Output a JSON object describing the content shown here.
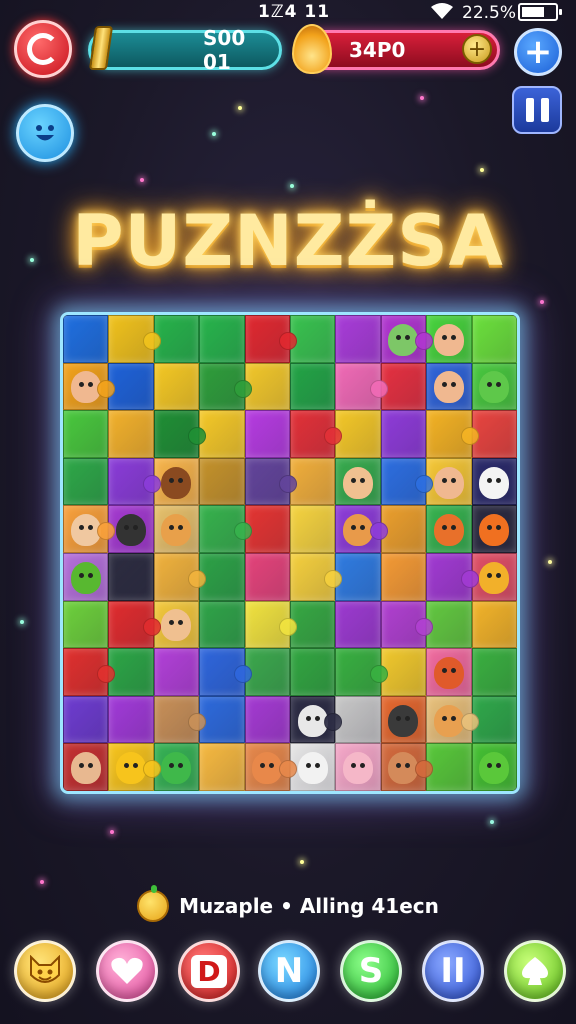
{
  "status_bar": {
    "time": "1ℤ4 11",
    "battery_percent": "22.5%"
  },
  "hud": {
    "left_counter": "S00 01",
    "right_counter": "34P0",
    "plus_label": "+",
    "coin_plus_label": "+",
    "pause_label": "II"
  },
  "title": "PUZNZŻSA",
  "board": {
    "columns": 10,
    "rows": 10,
    "tile_colors": [
      "#1f6fe0",
      "#f0c21c",
      "#26b34a",
      "#27b44b",
      "#e0282f",
      "#38c24e",
      "#a83cd8",
      "#b035d0",
      "#47d33c",
      "#6be03c",
      "#f2a21b",
      "#1e62d8",
      "#f4c823",
      "#2e9e3a",
      "#f1c729",
      "#22a445",
      "#f06ab5",
      "#e53040",
      "#2f64d8",
      "#48c83e",
      "#49c83d",
      "#f2b12b",
      "#1f8f34",
      "#f4c827",
      "#b53be0",
      "#e23037",
      "#f3c727",
      "#8e3bd8",
      "#f3b223",
      "#e8443f",
      "#2ea848",
      "#8a3cd8",
      "#f7b44a",
      "#c4922a",
      "#62449a",
      "#f0ae3a",
      "#36aa4c",
      "#2c6ee0",
      "#f5c735",
      "#2a2a6a",
      "#f8a03a",
      "#a43ad0",
      "#e6c06a",
      "#36b24c",
      "#e43431",
      "#f5d33e",
      "#8d3cd8",
      "#eb9f2c",
      "#36b24e",
      "#2a2a40",
      "#b46fda",
      "#2c2c40",
      "#f0b23c",
      "#2ca246",
      "#e4437a",
      "#f4cf3d",
      "#2f7be0",
      "#f49a34",
      "#a13ad2",
      "#e04f66",
      "#6dd03c",
      "#e02c2e",
      "#f3c83a",
      "#2fa448",
      "#f0e23e",
      "#36a842",
      "#9c3ad0",
      "#b040d0",
      "#62c840",
      "#f2b329",
      "#e0302e",
      "#2ca646",
      "#b240d8",
      "#2e66dc",
      "#3ba84c",
      "#31a640",
      "#38b040",
      "#f0c82c",
      "#f06a9e",
      "#3ab040",
      "#6e3cd0",
      "#a13ad8",
      "#c89058",
      "#2d6adc",
      "#a43ad2",
      "#2c2c44",
      "#c7c7c7",
      "#e4682e",
      "#e8c07a",
      "#2fa84a",
      "#c43030",
      "#f7c41c",
      "#36b254",
      "#f6b940",
      "#e7884a",
      "#e6e6e6",
      "#f5a7c8",
      "#d46a3c",
      "#58c83a",
      "#44c032"
    ],
    "face_tiles": [
      {
        "index": 7,
        "color": "#7dc767"
      },
      {
        "index": 8,
        "color": "#f0b890"
      },
      {
        "index": 10,
        "color": "#f0b890"
      },
      {
        "index": 18,
        "color": "#f0b890"
      },
      {
        "index": 19,
        "color": "#5ec84a"
      },
      {
        "index": 32,
        "color": "#8a4a20"
      },
      {
        "index": 36,
        "color": "#f0c090"
      },
      {
        "index": 38,
        "color": "#f0b890"
      },
      {
        "index": 39,
        "color": "#f4f4f4"
      },
      {
        "index": 40,
        "color": "#f0c8a0"
      },
      {
        "index": 41,
        "color": "#333333"
      },
      {
        "index": 42,
        "color": "#e8a04a"
      },
      {
        "index": 46,
        "color": "#e89a4a"
      },
      {
        "index": 48,
        "color": "#e8702a"
      },
      {
        "index": 49,
        "color": "#f07020"
      },
      {
        "index": 50,
        "color": "#58b830"
      },
      {
        "index": 59,
        "color": "#f2b02a"
      },
      {
        "index": 62,
        "color": "#f0c090"
      },
      {
        "index": 78,
        "color": "#e05a2a"
      },
      {
        "index": 85,
        "color": "#e8e8e8"
      },
      {
        "index": 87,
        "color": "#3a3a3a"
      },
      {
        "index": 88,
        "color": "#e8a050"
      },
      {
        "index": 90,
        "color": "#e8b890"
      },
      {
        "index": 91,
        "color": "#f7c41c"
      },
      {
        "index": 92,
        "color": "#3fb84a"
      },
      {
        "index": 94,
        "color": "#e8884a"
      },
      {
        "index": 95,
        "color": "#f2f2f2"
      },
      {
        "index": 96,
        "color": "#f5b7c8"
      },
      {
        "index": 97,
        "color": "#d48a5a"
      },
      {
        "index": 99,
        "color": "#5ac83a"
      }
    ]
  },
  "footer": {
    "text": "Muzaple • Alling 41ecn"
  },
  "dock": {
    "btn3_label": "D",
    "btn4_label": "N",
    "btn5_label": "S",
    "btn6_label": "II",
    "btn2_icon": "heart-icon",
    "btn1_icon": "cat-face-icon",
    "btn7_icon": "spade-icon"
  }
}
